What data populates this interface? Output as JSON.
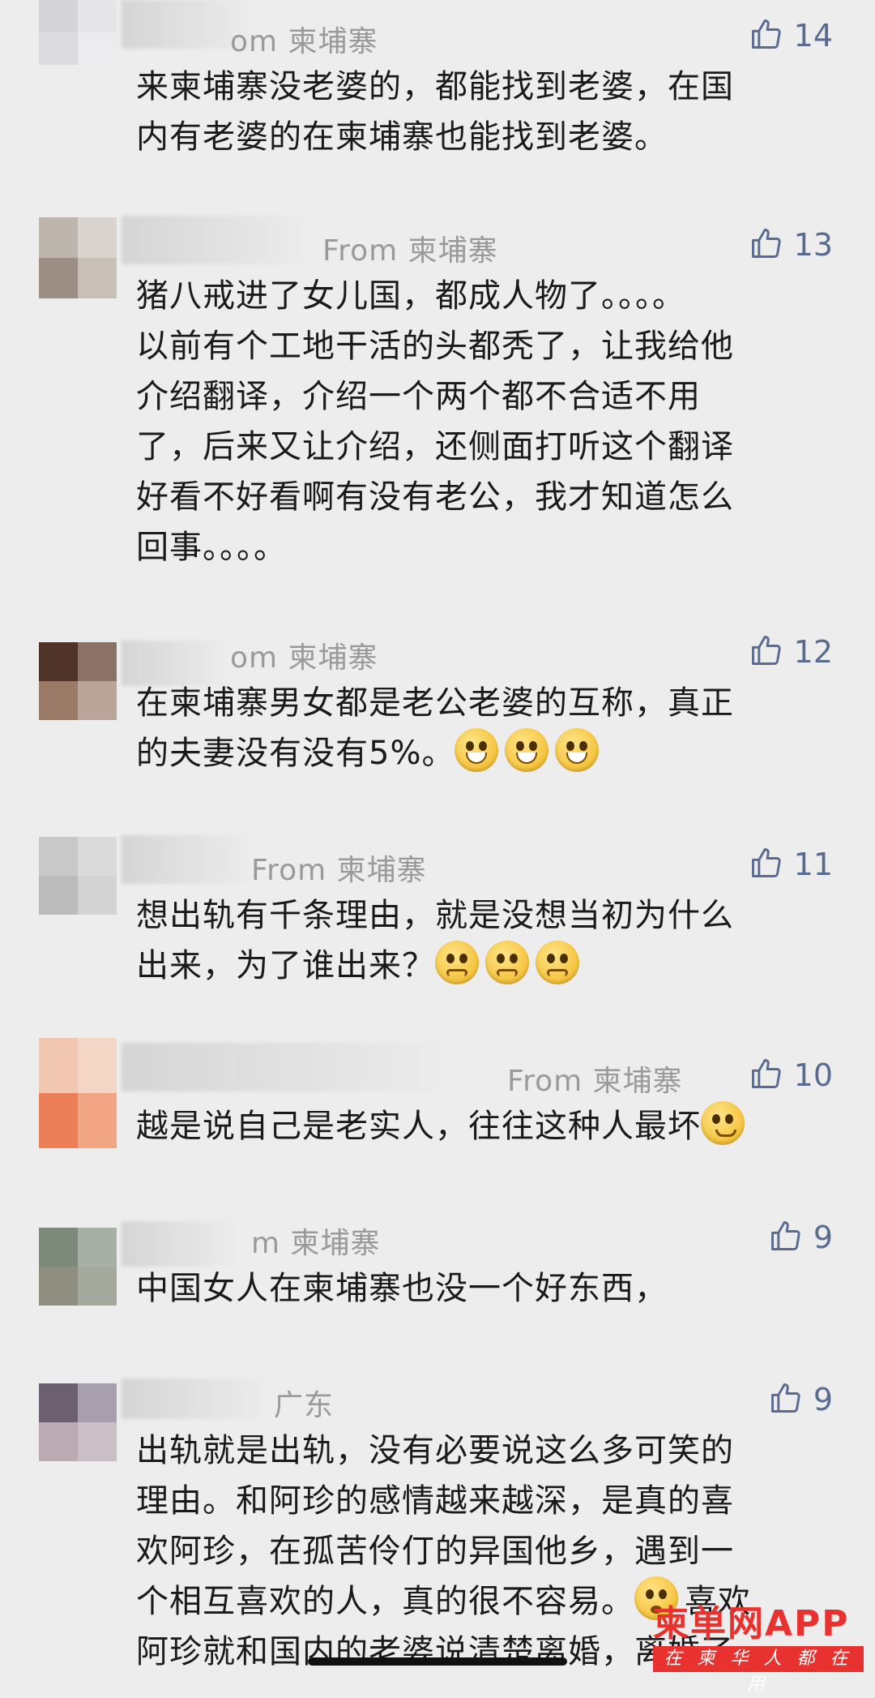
{
  "comments": [
    {
      "from": "om 柬埔寨",
      "likes": "14",
      "text": "来柬埔寨没老婆的，都能找到老婆，在国\n内有老婆的在柬埔寨也能找到老婆。",
      "avatar_colors": [
        "#d5d5d8",
        "#e6e6e8",
        "#dcdcdf",
        "#ececee"
      ]
    },
    {
      "from": "From 柬埔寨",
      "likes": "13",
      "text": "猪八戒进了女儿国，都成人物了。。。。\n以前有个工地干活的头都秃了，让我给他\n介绍翻译，介绍一个两个都不合适不用\n了，后来又让介绍，还侧面打听这个翻译\n好看不好看啊有没有老公，我才知道怎么\n回事。。。。",
      "avatar_colors": [
        "#bdb5ae",
        "#d9d4cf",
        "#9c8e84",
        "#c8bfb7"
      ]
    },
    {
      "from": "om 柬埔寨",
      "likes": "12",
      "text": "在柬埔寨男女都是老公老婆的互称，真正\n的夫妻没有没有5%。",
      "emoji": [
        "grin",
        "grin",
        "grin"
      ],
      "avatar_colors": [
        "#4f3328",
        "#8a7266",
        "#9c7a68",
        "#b9a59a"
      ]
    },
    {
      "from": "From 柬埔寨",
      "likes": "11",
      "text": "想出轨有千条理由，就是没想当初为什么\n出来，为了谁出来？",
      "emoji": [
        "worried",
        "worried",
        "worried"
      ],
      "avatar_colors": [
        "#c9c9c9",
        "#dadada",
        "#bcbcbc",
        "#d3d3d3"
      ]
    },
    {
      "from": "From 柬埔寨",
      "likes": "10",
      "text": "越是说自己是老实人，往往这种人最坏",
      "emoji": [
        "smirk"
      ],
      "avatar_colors": [
        "#f2c7b2",
        "#f4d6c6",
        "#ec7f57",
        "#f1a584"
      ]
    },
    {
      "from": "m 柬埔寨",
      "likes": "9",
      "text": "中国女人在柬埔寨也没一个好东西，",
      "avatar_colors": [
        "#7d8a7b",
        "#a7b0a5",
        "#8e8f81",
        "#a5a89c"
      ]
    },
    {
      "from": "广东",
      "likes": "9",
      "text": "出轨就是出轨，没有必要说这么多可笑的\n理由。和阿珍的感情越来越深，是真的喜\n欢阿珍，在孤苦伶仃的异国他乡，遇到一\n个相互喜欢的人，真的很不容易。",
      "text_tail": "喜欢\n阿珍就和国内的老婆说清楚离婚，离婚了",
      "emoji": [
        "shock"
      ],
      "avatar_colors": [
        "#6b5f70",
        "#a79fae",
        "#bba9b3",
        "#cbbfc6"
      ]
    }
  ],
  "watermark": {
    "title": "柬单网APP",
    "subtitle": "在 柬 华 人 都 在 用"
  }
}
